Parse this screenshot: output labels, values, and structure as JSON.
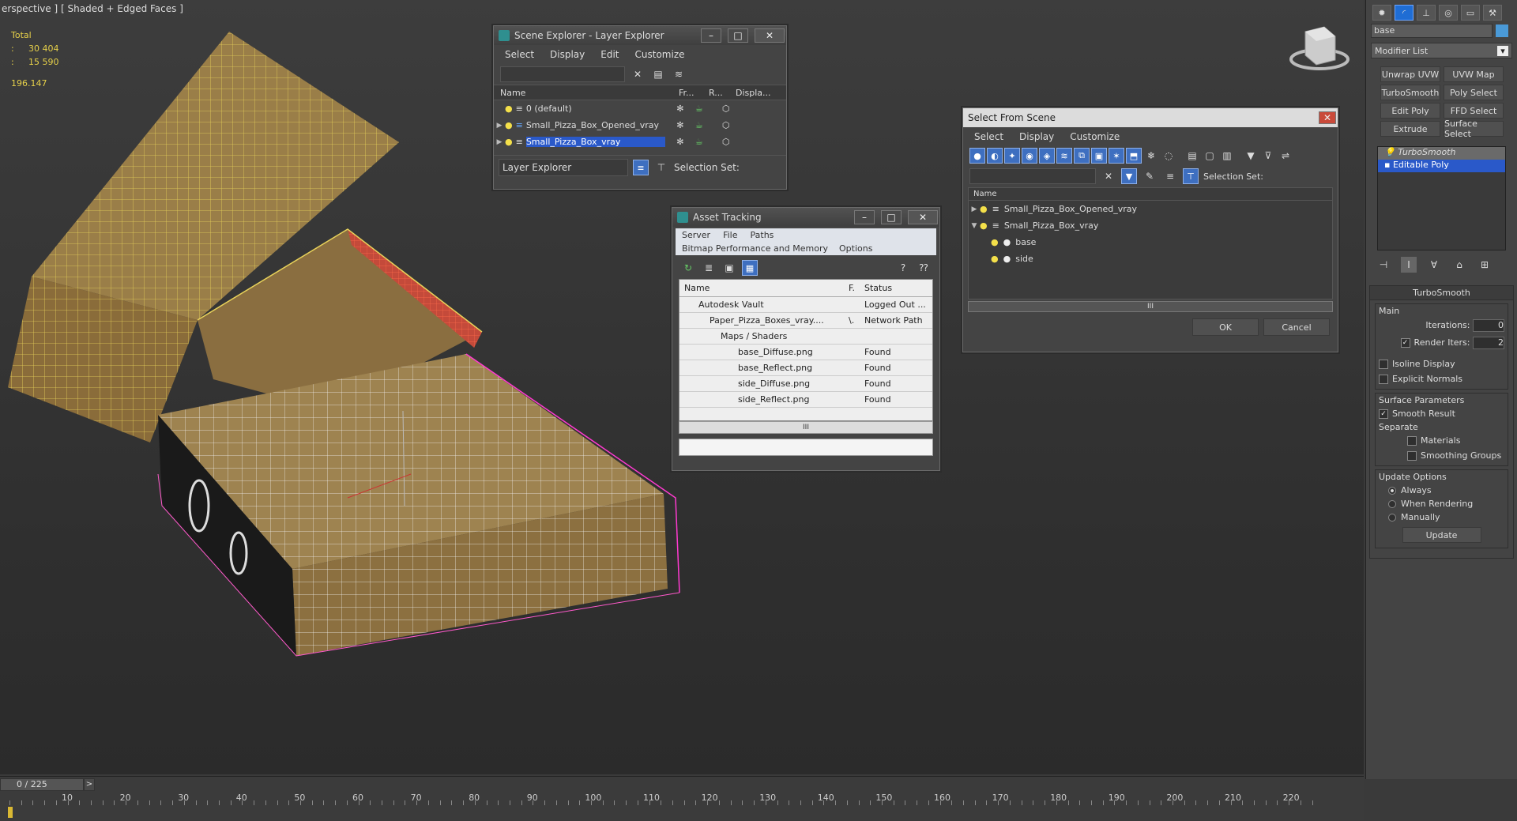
{
  "viewport": {
    "label": "erspective ] [ Shaded + Edged Faces ]",
    "stats": {
      "header": "Total",
      "poly_key": ":",
      "poly": "30 404",
      "vert_key": ":",
      "vert": "15 590",
      "fps": "196.147"
    }
  },
  "scene_explorer": {
    "title": "Scene Explorer - Layer Explorer",
    "menu": [
      "Select",
      "Display",
      "Edit",
      "Customize"
    ],
    "columns": {
      "name": "Name",
      "frozen": "Fr...",
      "render": "R...",
      "display": "Displa..."
    },
    "rows": [
      {
        "label": "0 (default)"
      },
      {
        "label": "Small_Pizza_Box_Opened_vray"
      },
      {
        "label": "Small_Pizza_Box_vray"
      }
    ],
    "footer": {
      "dropdown": "Layer Explorer",
      "selection_set": "Selection Set:"
    }
  },
  "asset_tracking": {
    "title": "Asset Tracking",
    "menu1": [
      "Server",
      "File",
      "Paths"
    ],
    "menu2": [
      "Bitmap Performance and Memory",
      "Options"
    ],
    "columns": {
      "name": "Name",
      "f": "F.",
      "status": "Status"
    },
    "rows": [
      {
        "name": "Autodesk Vault",
        "f": "",
        "status": "Logged Out ..."
      },
      {
        "name": "Paper_Pizza_Boxes_vray....",
        "f": "\\.",
        "status": "Network Path"
      },
      {
        "name": "Maps / Shaders",
        "f": "",
        "status": ""
      },
      {
        "name": "base_Diffuse.png",
        "f": "",
        "status": "Found"
      },
      {
        "name": "base_Reflect.png",
        "f": "",
        "status": "Found"
      },
      {
        "name": "side_Diffuse.png",
        "f": "",
        "status": "Found"
      },
      {
        "name": "side_Reflect.png",
        "f": "",
        "status": "Found"
      }
    ],
    "scroll_grip": "III"
  },
  "select_from_scene": {
    "title": "Select From Scene",
    "menu": [
      "Select",
      "Display",
      "Customize"
    ],
    "selection_set": "Selection Set:",
    "column": "Name",
    "rows": [
      {
        "label": "Small_Pizza_Box_Opened_vray"
      },
      {
        "label": "Small_Pizza_Box_vray"
      },
      {
        "label": "base"
      },
      {
        "label": "side"
      }
    ],
    "scroll_grip": "III",
    "ok": "OK",
    "cancel": "Cancel"
  },
  "command_panel": {
    "object_name": "base",
    "modifier_list": "Modifier List",
    "buttons": [
      [
        "Unwrap UVW",
        "UVW Map"
      ],
      [
        "TurboSmooth",
        "Poly Select"
      ],
      [
        "Edit Poly",
        "FFD Select"
      ],
      [
        "Extrude",
        "Surface Select"
      ]
    ],
    "stack": [
      "TurboSmooth",
      "Editable Poly"
    ],
    "turbosmooth": {
      "title": "TurboSmooth",
      "main": "Main",
      "iterations_label": "Iterations:",
      "iterations": "0",
      "render_iters_label": "Render Iters:",
      "render_iters": "2",
      "isoline": "Isoline Display",
      "explicit": "Explicit Normals",
      "surface_params": "Surface Parameters",
      "smooth_result": "Smooth Result",
      "separate": "Separate",
      "materials": "Materials",
      "smoothing_groups": "Smoothing Groups",
      "update_options": "Update Options",
      "always": "Always",
      "when_rendering": "When Rendering",
      "manually": "Manually",
      "update": "Update"
    }
  },
  "timeline": {
    "frame": "0 / 225",
    "arrow": ">",
    "ticks": [
      "10",
      "20",
      "30",
      "40",
      "50",
      "60",
      "70",
      "80",
      "90",
      "100",
      "110",
      "120",
      "130",
      "140",
      "150",
      "160",
      "170",
      "180",
      "190",
      "200",
      "210",
      "220"
    ]
  }
}
